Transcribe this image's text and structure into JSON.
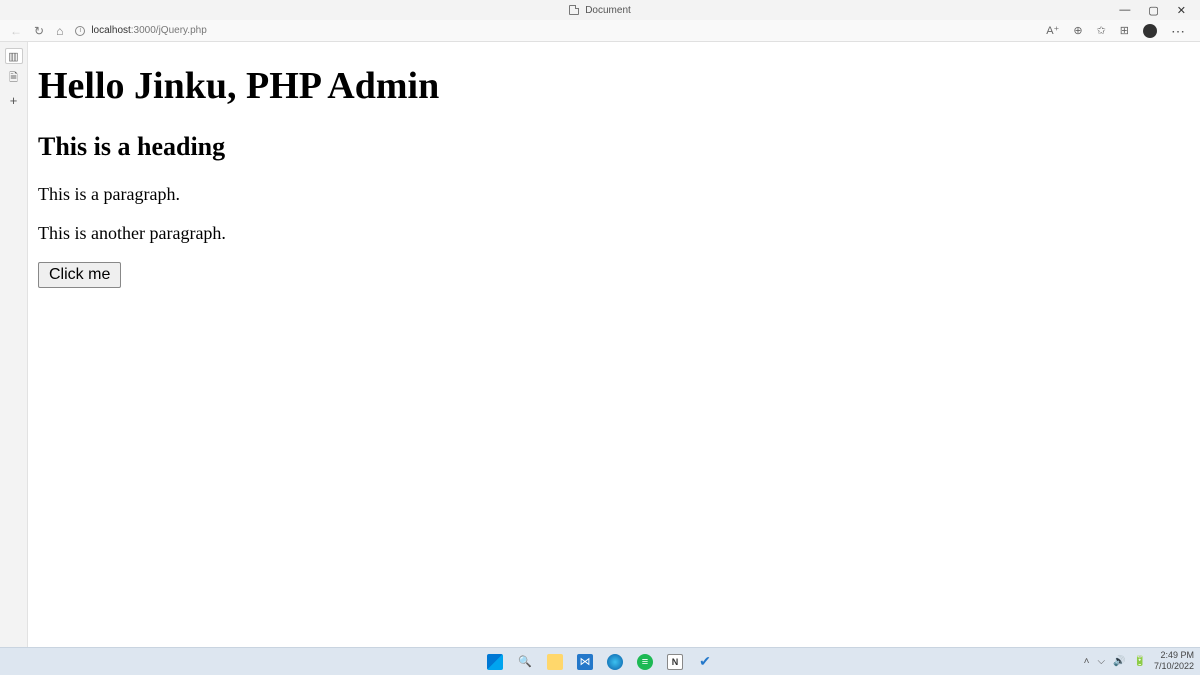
{
  "window": {
    "tab_title": "Document",
    "minimize": "—",
    "maximize": "▢",
    "close": "✕"
  },
  "browser": {
    "url_host": "localhost",
    "url_path": ":3000/jQuery.php"
  },
  "page_content": {
    "h1": "Hello Jinku, PHP Admin",
    "h2": "This is a heading",
    "p1": "This is a paragraph.",
    "p2": "This is another paragraph.",
    "button": "Click me"
  },
  "taskbar": {
    "notion": "N",
    "time": "2:49 PM",
    "date": "7/10/2022"
  }
}
